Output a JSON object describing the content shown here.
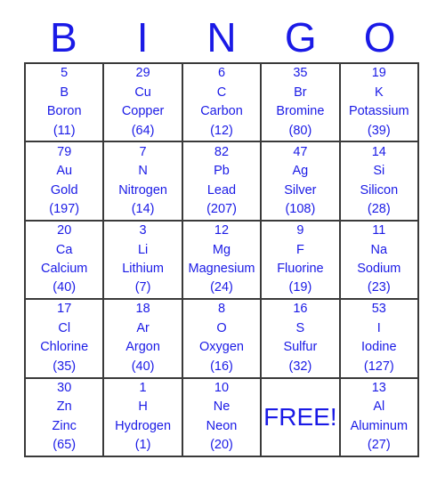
{
  "header": {
    "letters": [
      "B",
      "I",
      "N",
      "G",
      "O"
    ]
  },
  "grid": {
    "free_label": "FREE!",
    "accent_color": "#1a1ae6",
    "border_color": "#3a3a3a",
    "rows": [
      [
        {
          "number": "5",
          "symbol": "B",
          "name": "Boron",
          "mass": "(11)"
        },
        {
          "number": "29",
          "symbol": "Cu",
          "name": "Copper",
          "mass": "(64)"
        },
        {
          "number": "6",
          "symbol": "C",
          "name": "Carbon",
          "mass": "(12)"
        },
        {
          "number": "35",
          "symbol": "Br",
          "name": "Bromine",
          "mass": "(80)"
        },
        {
          "number": "19",
          "symbol": "K",
          "name": "Potassium",
          "mass": "(39)"
        }
      ],
      [
        {
          "number": "79",
          "symbol": "Au",
          "name": "Gold",
          "mass": "(197)"
        },
        {
          "number": "7",
          "symbol": "N",
          "name": "Nitrogen",
          "mass": "(14)"
        },
        {
          "number": "82",
          "symbol": "Pb",
          "name": "Lead",
          "mass": "(207)"
        },
        {
          "number": "47",
          "symbol": "Ag",
          "name": "Silver",
          "mass": "(108)"
        },
        {
          "number": "14",
          "symbol": "Si",
          "name": "Silicon",
          "mass": "(28)"
        }
      ],
      [
        {
          "number": "20",
          "symbol": "Ca",
          "name": "Calcium",
          "mass": "(40)"
        },
        {
          "number": "3",
          "symbol": "Li",
          "name": "Lithium",
          "mass": "(7)"
        },
        {
          "number": "12",
          "symbol": "Mg",
          "name": "Magnesium",
          "mass": "(24)"
        },
        {
          "number": "9",
          "symbol": "F",
          "name": "Fluorine",
          "mass": "(19)"
        },
        {
          "number": "11",
          "symbol": "Na",
          "name": "Sodium",
          "mass": "(23)"
        }
      ],
      [
        {
          "number": "17",
          "symbol": "Cl",
          "name": "Chlorine",
          "mass": "(35)"
        },
        {
          "number": "18",
          "symbol": "Ar",
          "name": "Argon",
          "mass": "(40)"
        },
        {
          "number": "8",
          "symbol": "O",
          "name": "Oxygen",
          "mass": "(16)"
        },
        {
          "number": "16",
          "symbol": "S",
          "name": "Sulfur",
          "mass": "(32)"
        },
        {
          "number": "53",
          "symbol": "I",
          "name": "Iodine",
          "mass": "(127)"
        }
      ],
      [
        {
          "number": "30",
          "symbol": "Zn",
          "name": "Zinc",
          "mass": "(65)"
        },
        {
          "number": "1",
          "symbol": "H",
          "name": "Hydrogen",
          "mass": "(1)"
        },
        {
          "number": "10",
          "symbol": "Ne",
          "name": "Neon",
          "mass": "(20)"
        },
        {
          "free": true,
          "label": "FREE!"
        },
        {
          "number": "13",
          "symbol": "Al",
          "name": "Aluminum",
          "mass": "(27)"
        }
      ]
    ]
  }
}
